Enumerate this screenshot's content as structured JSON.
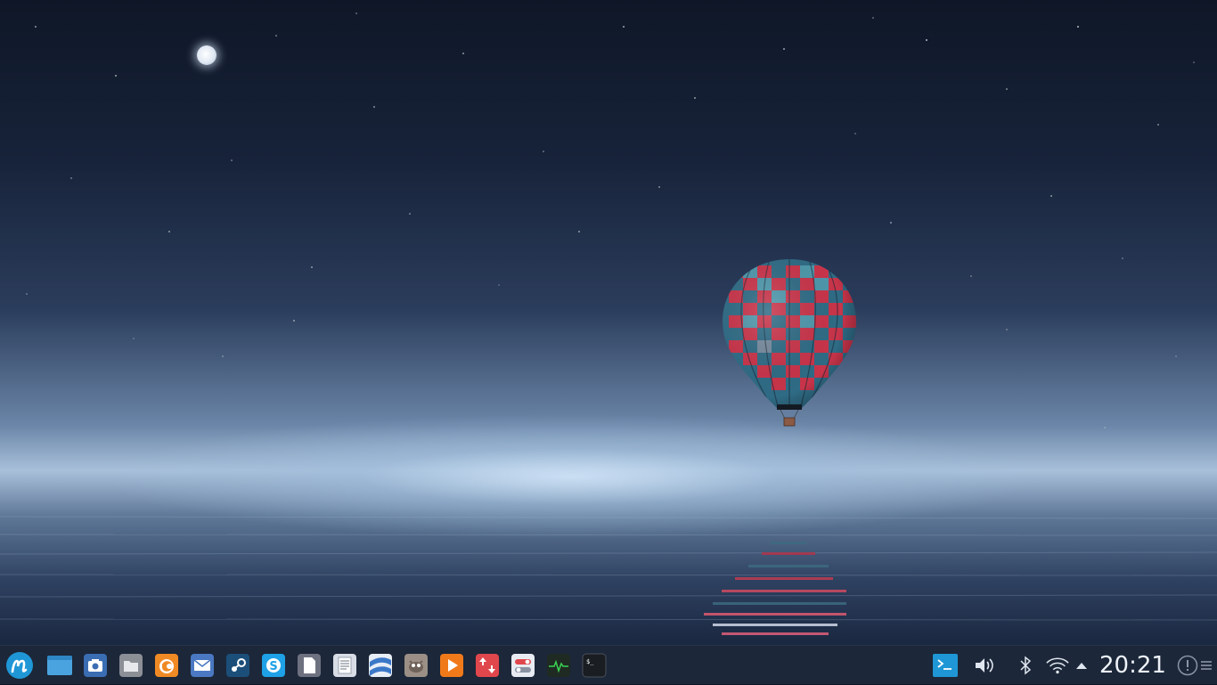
{
  "desktop": {
    "wallpaper": "hot-air-balloon-over-night-sea",
    "moon_icon": "moon",
    "balloon_icon": "hot-air-balloon"
  },
  "taskbar": {
    "launcher_icon": "application-launcher-icon",
    "apps": [
      {
        "name": "desktop-folder",
        "color": "#4aa3df"
      },
      {
        "name": "screenshot-camera",
        "color": "#3b6db3"
      },
      {
        "name": "file-manager",
        "color": "#8c8f96"
      },
      {
        "name": "firefox",
        "color": "#f08a24"
      },
      {
        "name": "mail",
        "color": "#4a78c2"
      },
      {
        "name": "steam",
        "color": "#1b4f7a"
      },
      {
        "name": "skype",
        "color": "#1ea1e6"
      },
      {
        "name": "document",
        "color": "#6e7280"
      },
      {
        "name": "text-editor",
        "color": "#d8dde6"
      },
      {
        "name": "google-earth",
        "color": "#3c78c8"
      },
      {
        "name": "gimp",
        "color": "#9b8f86"
      },
      {
        "name": "media-player",
        "color": "#f07a1a"
      },
      {
        "name": "transfer",
        "color": "#e0474c"
      },
      {
        "name": "settings-toggles",
        "color": "#e8ecf2"
      },
      {
        "name": "system-monitor",
        "color": "#1f2a22"
      },
      {
        "name": "terminal",
        "color": "#1a1d22"
      }
    ],
    "tray": {
      "terminal_dropdown_icon": "dropdown-terminal-icon",
      "volume_icon": "volume-icon",
      "bluetooth_icon": "bluetooth-icon",
      "wifi_icon": "wifi-icon",
      "expand_icon": "tray-expand-icon",
      "clock": "20:21",
      "notifications_icon": "notifications-icon",
      "menu_icon": "hamburger-menu-icon"
    }
  }
}
